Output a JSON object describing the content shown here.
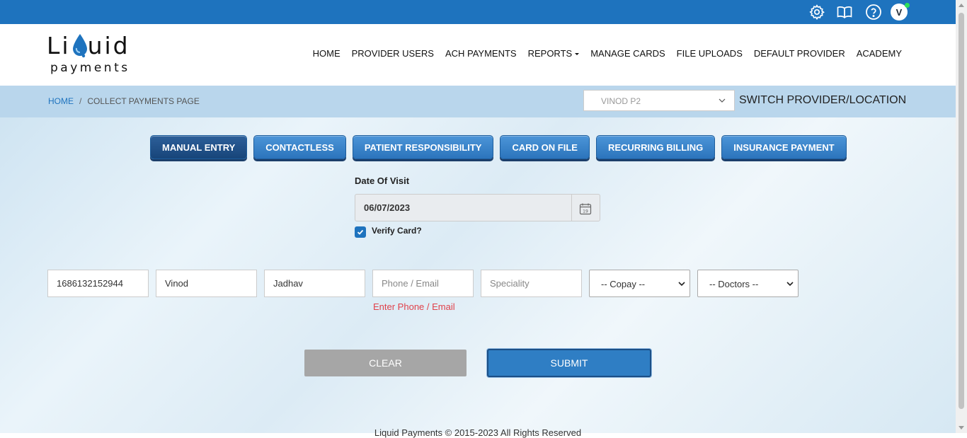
{
  "logo": {
    "top": "Liquid",
    "top_left": "Li",
    "top_right": "uid",
    "bottom": "payments"
  },
  "avatar": {
    "initial": "V"
  },
  "icons": {
    "settings": "gear-icon",
    "docs": "book-icon",
    "help": "question-icon"
  },
  "nav": {
    "items": [
      {
        "label": "HOME"
      },
      {
        "label": "PROVIDER USERS"
      },
      {
        "label": "ACH PAYMENTS"
      },
      {
        "label": "REPORTS"
      },
      {
        "label": "MANAGE CARDS"
      },
      {
        "label": "FILE UPLOADS"
      },
      {
        "label": "DEFAULT PROVIDER"
      },
      {
        "label": "ACADEMY"
      }
    ]
  },
  "breadcrumb": {
    "home": "HOME",
    "separator": "/",
    "current": "COLLECT PAYMENTS PAGE"
  },
  "provider": {
    "selected": "VINOD P2",
    "switch_label": "SWITCH PROVIDER/LOCATION"
  },
  "tabs": [
    {
      "label": "MANUAL ENTRY",
      "active": true
    },
    {
      "label": "CONTACTLESS"
    },
    {
      "label": "PATIENT RESPONSIBILITY"
    },
    {
      "label": "CARD ON FILE"
    },
    {
      "label": "RECURRING BILLING"
    },
    {
      "label": "INSURANCE PAYMENT"
    }
  ],
  "visit": {
    "label": "Date Of Visit",
    "value": "06/07/2023",
    "calendar_day": "19"
  },
  "verify": {
    "label": "Verify Card?",
    "checked": true
  },
  "fields": {
    "id": {
      "value": "1686132152944"
    },
    "first_name": {
      "value": "Vinod"
    },
    "last_name": {
      "value": "Jadhav"
    },
    "contact": {
      "placeholder": "Phone / Email",
      "error": "Enter Phone / Email"
    },
    "speciality": {
      "placeholder": "Speciality"
    },
    "copay": {
      "selected": "-- Copay --"
    },
    "doctors": {
      "selected": "-- Doctors --"
    }
  },
  "buttons": {
    "clear": "CLEAR",
    "submit": "SUBMIT"
  },
  "footer": {
    "text": "Liquid Payments © 2015-2023 All Rights Reserved"
  },
  "colors": {
    "primary": "#1e73be",
    "tab": "#2c74bc",
    "error": "#e0424b",
    "clear": "#a6a6a6"
  }
}
